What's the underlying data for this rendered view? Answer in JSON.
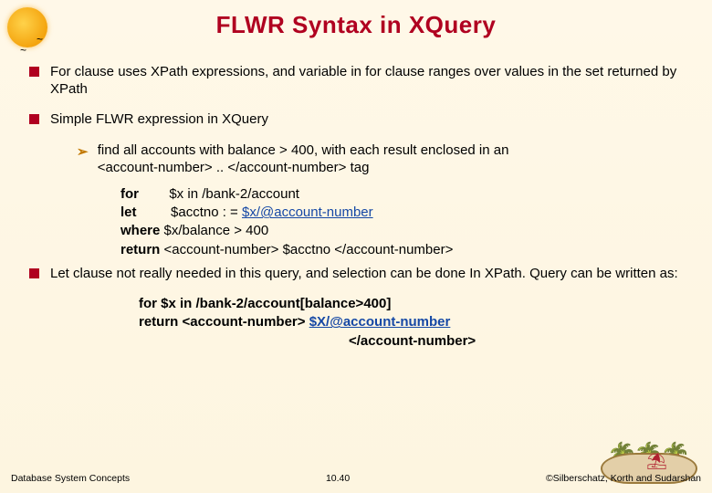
{
  "title": "FLWR Syntax in XQuery",
  "bullets": {
    "b1": "For clause uses XPath expressions, and variable in for clause ranges over values in the set returned by XPath",
    "b2": "Simple FLWR expression in XQuery",
    "b3": "Let clause not really needed in this query, and selection can be done In XPath.  Query can be written as:"
  },
  "sub1": {
    "line1": "find all accounts with balance > 400, with each result enclosed in an",
    "line2": "<account-number> .. </account-number> tag"
  },
  "code1": {
    "for_kw": "for",
    "for_rest": "        $x ",
    "in_kw": "in",
    "for_path": " /bank-2/account",
    "let_kw": "let",
    "let_mid": "         $acctno : = ",
    "let_link": "$x/@account-number",
    "where_kw": "where",
    "where_rest": " $x/balance > 400",
    "return_kw": "return",
    "return_rest": " <account-number> $acctno </account-number>"
  },
  "code2": {
    "line1": "for $x in /bank-2/account[balance>400]",
    "line2a": "return <account-number> ",
    "line2_link": "$X/@account-number",
    "line3": "</account-number>"
  },
  "footer": {
    "left": "Database System Concepts",
    "center": "10.40",
    "right": "©Silberschatz, Korth and Sudarshan"
  }
}
